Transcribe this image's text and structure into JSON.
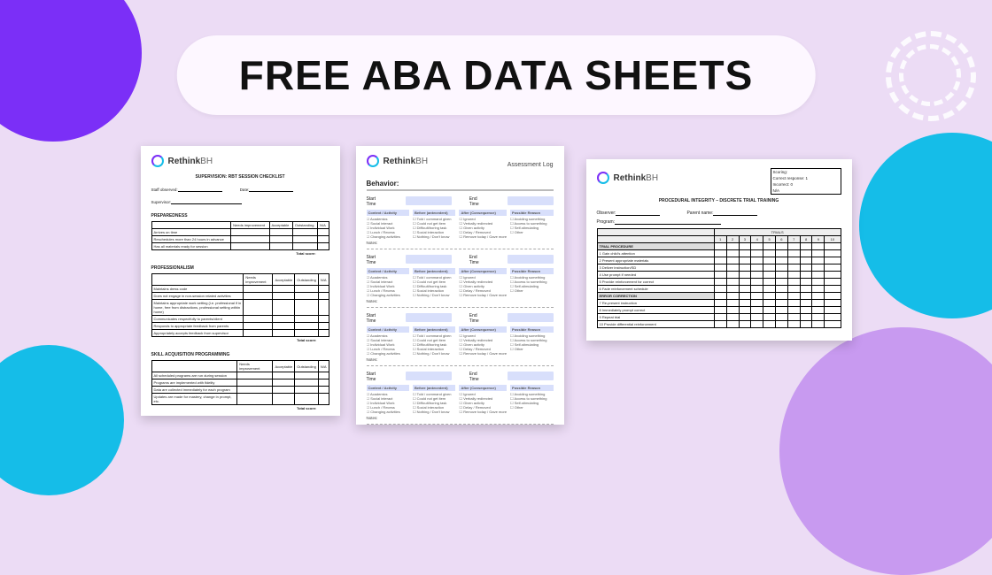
{
  "title": "FREE ABA DATA SHEETS",
  "logo": {
    "brand": "Rethink",
    "suffix": "BH"
  },
  "sheet_a": {
    "heading": "SUPERVISION: RBT SESSION CHECKLIST",
    "staff_label": "Staff observed:",
    "date_label": "Date:",
    "supervisor_label": "Supervisor:",
    "cols": [
      "Needs improvement",
      "Acceptable",
      "Outstanding",
      "N/A"
    ],
    "total_label": "Total score:",
    "sections": [
      {
        "title": "PREPAREDNESS",
        "rows": [
          "Arrives on time",
          "Reschedules more than 24 hours in advance",
          "Has all materials ready for session"
        ]
      },
      {
        "title": "PROFESSIONALISM",
        "rows": [
          "Maintains dress code",
          "Does not engage in non-session related activities",
          "Maintains appropriate work setting (i.e. professional if in home, free from distractions, professional setting within home)",
          "Communicates respectfully to parents/client",
          "Responds to appropriate feedback from parents",
          "Appropriately accepts feedback from supervisor"
        ]
      },
      {
        "title": "SKILL ACQUISITION PROGRAMMING",
        "rows": [
          "All scheduled programs are run during session",
          "Programs are implemented with fidelity",
          "Data are collected immediately for each program",
          "Updates are made for mastery, change in prompt, etc."
        ]
      }
    ]
  },
  "sheet_b": {
    "assessment_label": "Assessment Log",
    "behavior_label": "Behavior:",
    "start_label": "Start Time",
    "end_label": "End Time",
    "cols": [
      "Context / Activity",
      "Before (antecedent)",
      "After (Consequence)",
      "Possible Reason"
    ],
    "col_items": [
      [
        "Academics",
        "Social interact",
        "Individual Work",
        "Lunch / Recess",
        "Changing activities"
      ],
      [
        "Told / command given",
        "Could not get item",
        "Difficult/boring task",
        "Social interaction",
        "Nothing / Don't know"
      ],
      [
        "Ignored",
        "Verbally redirected",
        "Given activity",
        "Delay / Removed",
        "Remove today / Gave more"
      ],
      [
        "Avoiding something",
        "Access to something",
        "Self-stimulating",
        "Other"
      ]
    ],
    "notes_label": "Notes:",
    "block_count": 4
  },
  "sheet_c": {
    "heading": "PROCEDURAL INTEGRITY – DISCRETE TRIAL TRAINING",
    "scoring_title": "Scoring:",
    "scoring_rows": [
      "Correct response: 1",
      "Incorrect: 0",
      "N/A"
    ],
    "observer_label": "Observer:",
    "parent_label": "Parent name:",
    "program_label": "Program:",
    "trials_label": "TRIALS",
    "trial_nums": [
      "1",
      "2",
      "3",
      "4",
      "5",
      "6",
      "7",
      "8",
      "9",
      "10"
    ],
    "groups": [
      {
        "head": "TRIAL PROCEDURE",
        "rows": [
          "1 Gain child's attention",
          "2 Present appropriate materials",
          "3 Deliver instruction/SD",
          "4 Use prompt if needed",
          "5 Provide reinforcement for correct",
          "6 Fade reinforcement schedule"
        ]
      },
      {
        "head": "ERROR CORRECTION",
        "rows": [
          "7 Re-present instruction",
          "8 Immediately prompt correct",
          "9 Repeat trial",
          "10 Provide differential reinforcement"
        ]
      }
    ]
  }
}
